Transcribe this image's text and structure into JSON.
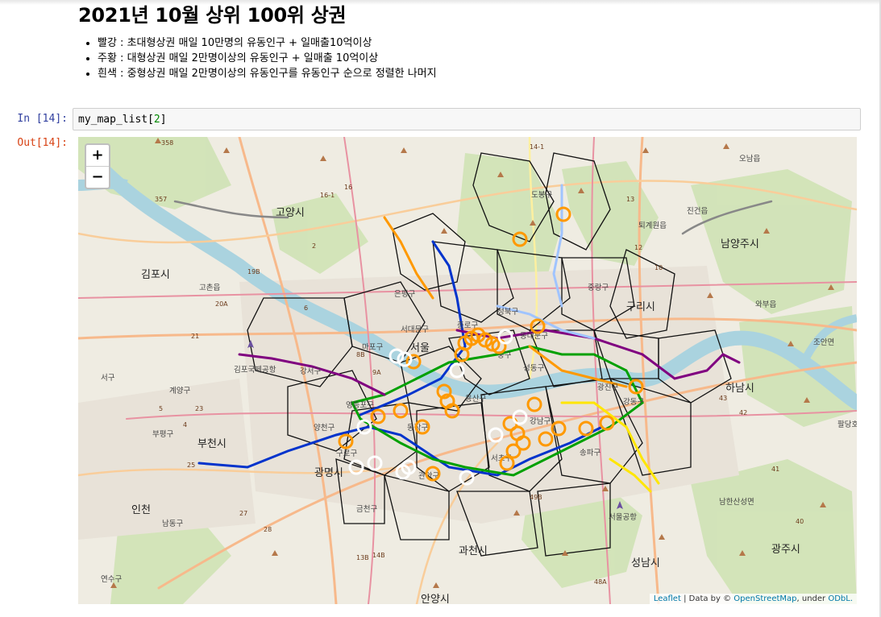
{
  "markdown": {
    "title": "2021년 10월 상위 100위 상권",
    "bullets": [
      "빨강 : 초대형상권 매일 10만명의 유동인구 + 일매출10억이상",
      "주황 : 대형상권 매일 2만명이상의 유동인구 + 일매출 10억이상",
      "흰색 : 중형상권 매일 2만명이상의 유동인구를 유동인구 순으로 정렬한 나머지"
    ]
  },
  "cell_in": {
    "prompt": "In [14]:",
    "code_name": "my_map_list",
    "code_index": "2",
    "code_open": "[",
    "code_close": "]"
  },
  "cell_out": {
    "prompt": "Out[14]:"
  },
  "map": {
    "zoom_in": "+",
    "zoom_out": "−",
    "attribution": {
      "leaflet": "Leaflet",
      "sep": " | Data by © ",
      "osm": "OpenStreetMap",
      "under": ", under ",
      "odbl": "ODbL."
    },
    "colors": {
      "orange": "#ff9900",
      "white": "#ffffff",
      "red": "#ff0000"
    },
    "cities": [
      {
        "label": "고양시"
      },
      {
        "label": "김포시"
      },
      {
        "label": "부천시"
      },
      {
        "label": "인천"
      },
      {
        "label": "구리시"
      },
      {
        "label": "남양주시"
      },
      {
        "label": "하남시"
      },
      {
        "label": "성남시"
      },
      {
        "label": "광주시"
      },
      {
        "label": "광명시"
      },
      {
        "label": "과천시"
      },
      {
        "label": "안양시"
      },
      {
        "label": "서울"
      },
      {
        "label": "조안면"
      },
      {
        "label": "와부읍"
      },
      {
        "label": "진건읍"
      },
      {
        "label": "오남읍"
      },
      {
        "label": "퇴계원읍"
      },
      {
        "label": "고촌읍"
      },
      {
        "label": "계양구"
      },
      {
        "label": "부평구"
      },
      {
        "label": "서구"
      },
      {
        "label": "남동구"
      },
      {
        "label": "연수구"
      },
      {
        "label": "남한산성면"
      },
      {
        "label": "팔당호"
      },
      {
        "label": "김포국제공항"
      },
      {
        "label": "서울공항"
      }
    ],
    "districts": [
      {
        "label": "은평구"
      },
      {
        "label": "서대문구"
      },
      {
        "label": "종로구"
      },
      {
        "label": "마포구"
      },
      {
        "label": "강서구"
      },
      {
        "label": "용산구"
      },
      {
        "label": "중랑구"
      },
      {
        "label": "성북구"
      },
      {
        "label": "동대문구"
      },
      {
        "label": "광진구"
      },
      {
        "label": "강동구"
      },
      {
        "label": "송파구"
      },
      {
        "label": "강남구"
      },
      {
        "label": "서초구"
      },
      {
        "label": "동작구"
      },
      {
        "label": "관악구"
      },
      {
        "label": "영등포구"
      },
      {
        "label": "구로구"
      },
      {
        "label": "금천구"
      },
      {
        "label": "도봉구"
      },
      {
        "label": "성동구"
      },
      {
        "label": "양천구"
      },
      {
        "label": "중구"
      }
    ],
    "road_numbers": [
      "14-1",
      "16-1",
      "16",
      "358",
      "357",
      "19B",
      "20A",
      "9A",
      "8B",
      "21",
      "23",
      "25",
      "27",
      "28",
      "13B",
      "14B",
      "48A",
      "49B",
      "42",
      "43",
      "40",
      "41",
      "13",
      "12",
      "10",
      "6",
      "5",
      "4",
      "2"
    ]
  }
}
